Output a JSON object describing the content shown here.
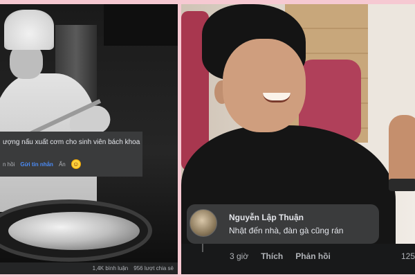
{
  "left_post": {
    "comment_text": "ượng nấu xuất cơm cho sinh viên bách khoa",
    "actions": {
      "reply": "n hồi",
      "send_message": "Gửi tin nhắn",
      "hide": "Ẩn"
    },
    "stats": {
      "comments": "1,4K bình luận",
      "shares": "956 lượt chia sẻ"
    }
  },
  "right_post": {
    "comment": {
      "author": "Nguyễn Lập Thuận",
      "text": "Nhật đến nhà, đàn gà cũng rán",
      "time": "3 giờ",
      "like": "Thích",
      "reply": "Phản hồi",
      "reaction_count": "125"
    }
  },
  "colors": {
    "frame_background": "#f6c9d2",
    "comment_bubble": "#3a3b3c",
    "link_blue": "#4b8bf5"
  }
}
